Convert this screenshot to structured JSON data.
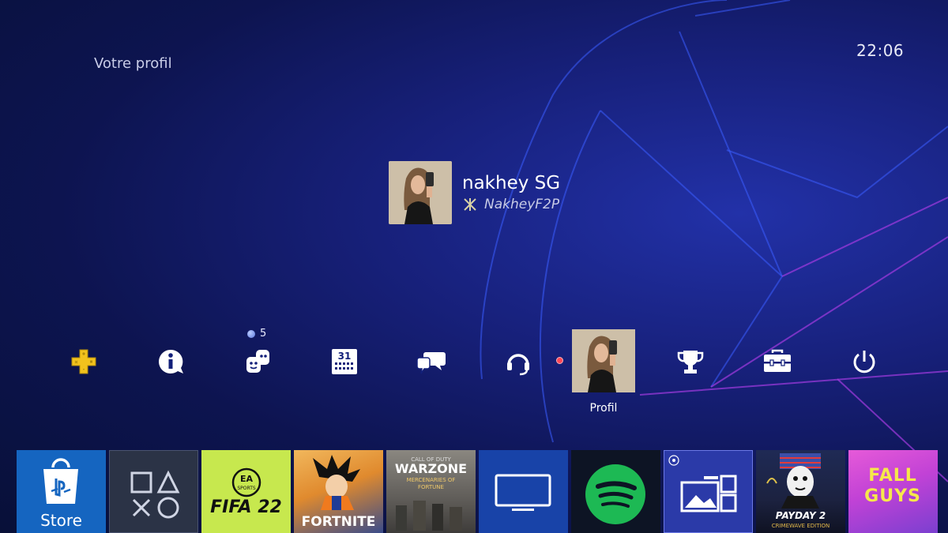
{
  "screen": {
    "title": "Votre profil",
    "clock": "22:06"
  },
  "profile": {
    "name": "nakhey SG",
    "online_id": "NakheyF2P"
  },
  "function_bar": {
    "items": [
      {
        "name": "ps-plus",
        "icon": "ps-plus-icon"
      },
      {
        "name": "whats-new",
        "icon": "info-bubble-icon"
      },
      {
        "name": "friends",
        "icon": "friends-icon",
        "badge": "5"
      },
      {
        "name": "events",
        "icon": "calendar-icon",
        "calendar_text": "31"
      },
      {
        "name": "messages",
        "icon": "messages-icon"
      },
      {
        "name": "party",
        "icon": "headset-icon"
      },
      {
        "name": "profile",
        "icon": "avatar",
        "label": "Profil",
        "status": "busy"
      },
      {
        "name": "trophies",
        "icon": "trophy-icon"
      },
      {
        "name": "settings",
        "icon": "toolbox-icon"
      },
      {
        "name": "power",
        "icon": "power-icon"
      }
    ]
  },
  "tiles": [
    {
      "name": "store",
      "label": "Store",
      "color": "#1565c0"
    },
    {
      "name": "library",
      "label": "",
      "color": "#2b3346"
    },
    {
      "name": "fifa22",
      "label": "FIFA 22",
      "sub": "SPORTS",
      "color": "#c7e84e"
    },
    {
      "name": "fortnite",
      "label": "FORTNITE",
      "color": "#e59a3b"
    },
    {
      "name": "warzone",
      "label": "WARZONE",
      "sub": "CALL OF DUTY",
      "subtitle": "MERCENARIES OF FORTUNE",
      "color": "#6c6a66"
    },
    {
      "name": "tv-video",
      "label": "",
      "color": "#1843a8"
    },
    {
      "name": "spotify",
      "label": "",
      "color": "#0d1424"
    },
    {
      "name": "share-factory",
      "label": "",
      "color": "#2b3aa8"
    },
    {
      "name": "payday2",
      "label": "PAYDAY 2",
      "subtitle": "CRIMEWAVE EDITION",
      "color": "#2a2e4a"
    },
    {
      "name": "fall-guys",
      "label": "FALL GUYS",
      "color": "#c142d6"
    }
  ],
  "colors": {
    "accent_blue": "#1565c0",
    "spotify_green": "#1db954",
    "ps_plus_gold": "#f2c21d",
    "status_busy": "#ff4657"
  }
}
